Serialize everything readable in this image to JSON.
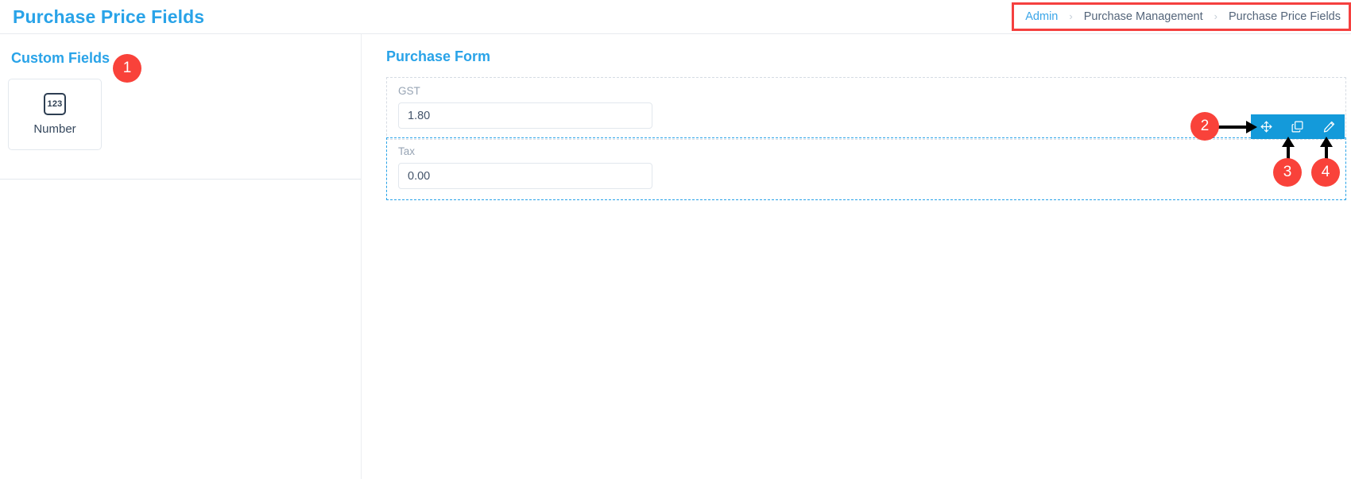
{
  "header": {
    "page_title": "Purchase Price Fields",
    "breadcrumb": [
      {
        "label": "Admin",
        "active": true
      },
      {
        "label": "Purchase Management",
        "active": false
      },
      {
        "label": "Purchase Price Fields",
        "active": false
      }
    ],
    "separator": "›"
  },
  "left_panel": {
    "title": "Custom Fields",
    "cards": [
      {
        "icon": "number-123-icon",
        "icon_text": "123",
        "label": "Number"
      }
    ]
  },
  "right_panel": {
    "title": "Purchase Form",
    "fields": [
      {
        "label": "GST",
        "value": "1.80",
        "placeholder": "",
        "selected": false
      },
      {
        "label": "Tax",
        "value": "0.00",
        "placeholder": "",
        "selected": true
      }
    ]
  },
  "action_toolbar": {
    "buttons": [
      {
        "name": "move-icon",
        "title": "Move"
      },
      {
        "name": "duplicate-icon",
        "title": "Duplicate"
      },
      {
        "name": "edit-pencil-icon",
        "title": "Edit"
      }
    ]
  },
  "annotations": [
    {
      "number": "1"
    },
    {
      "number": "2"
    },
    {
      "number": "3"
    },
    {
      "number": "4"
    }
  ],
  "colors": {
    "accent_blue": "#29a3e8",
    "toolbar_blue": "#149ada",
    "annotation_red": "#f9423a",
    "highlight_outline_red": "#f5403f",
    "text_dark": "#36485e",
    "text_muted": "#97a4b4"
  }
}
